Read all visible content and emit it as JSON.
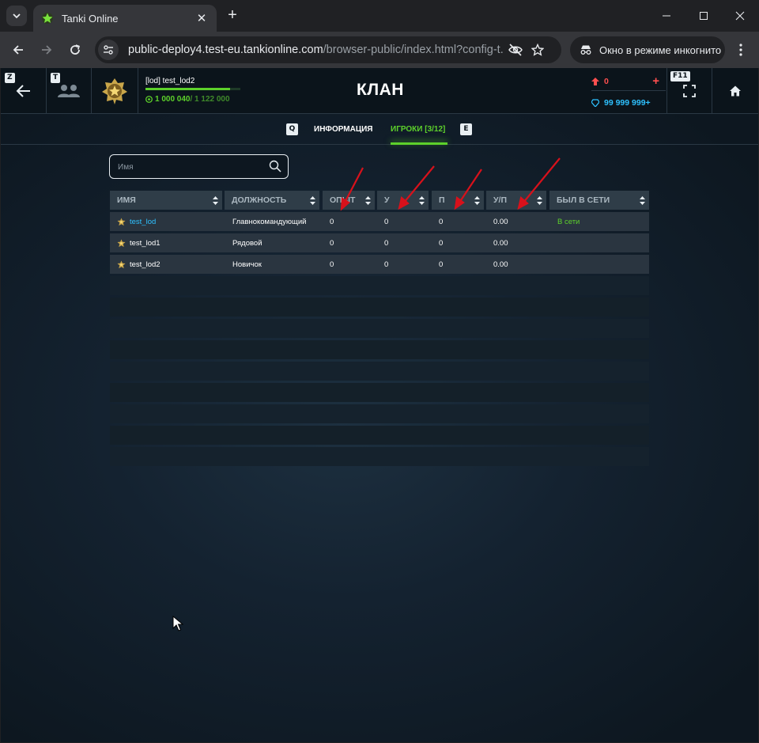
{
  "browser": {
    "tab_title": "Tanki Online",
    "url_main": "public-deploy4.test-eu.tankionline.com",
    "url_rest": "/browser-public/index.html?config-t...",
    "incognito_label": "Окно в режиме инкогнито"
  },
  "topbar": {
    "back_key": "Z",
    "friends_key": "T",
    "fullscreen_key": "F11",
    "player_name": "[lod] test_lod2",
    "xp_current": "1 000 040",
    "xp_total": " / 1 122 000",
    "xp_progress": 0.89,
    "page_title": "КЛАН",
    "red_points": "0",
    "crystals": "99 999 999+"
  },
  "tabs": {
    "prev_key": "Q",
    "info_label": "ИНФОРМАЦИЯ",
    "players_label": "ИГРОКИ [3/12]",
    "next_key": "E"
  },
  "search": {
    "placeholder": "Имя"
  },
  "table": {
    "headers": [
      "ИМЯ",
      "ДОЛЖНОСТЬ",
      "ОПЫТ",
      "У",
      "П",
      "У/П",
      "БЫЛ В СЕТИ"
    ],
    "rows": [
      {
        "name": "test_lod",
        "role": "Главнокомандующий",
        "exp": "0",
        "kills": "0",
        "deaths": "0",
        "kd": "0.00",
        "last_seen": "В сети",
        "self": true
      },
      {
        "name": "test_lod1",
        "role": "Рядовой",
        "exp": "0",
        "kills": "0",
        "deaths": "0",
        "kd": "0.00",
        "last_seen": "",
        "self": false
      },
      {
        "name": "test_lod2",
        "role": "Новичок",
        "exp": "0",
        "kills": "0",
        "deaths": "0",
        "kd": "0.00",
        "last_seen": "",
        "self": false
      }
    ],
    "empty_rows": 9
  },
  "colors": {
    "accent_green": "#5dd12b",
    "crystal_blue": "#2ec1ff",
    "points_red": "#ff4f4f",
    "annotation_arrow": "#d8111b"
  },
  "icons": {
    "rank": "rank-star-icon",
    "back": "arrow-left-icon",
    "friends": "friends-icon",
    "fullscreen": "fullscreen-icon",
    "home": "home-icon"
  }
}
